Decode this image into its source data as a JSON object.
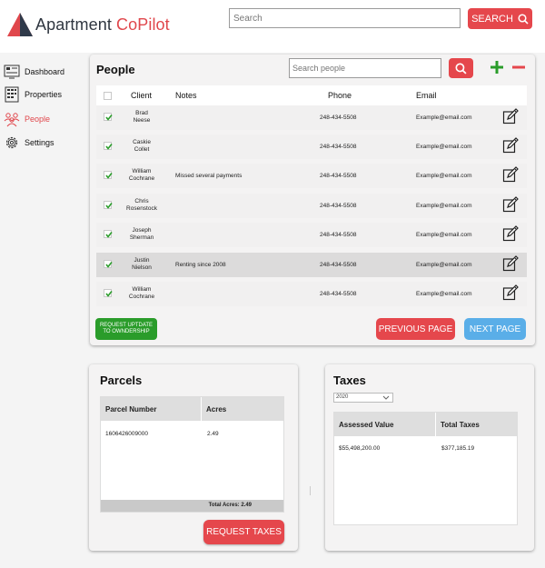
{
  "brand": {
    "part1": "Apartment ",
    "part2": "CoPilot"
  },
  "header": {
    "search_placeholder": "Search",
    "search_button": "SEARCH"
  },
  "sidebar": {
    "items": [
      {
        "label": "Dashboard",
        "icon": "dashboard-icon"
      },
      {
        "label": "Properties",
        "icon": "properties-icon"
      },
      {
        "label": "People",
        "icon": "people-icon",
        "active": true
      },
      {
        "label": "Settings",
        "icon": "gear-icon"
      }
    ]
  },
  "people": {
    "title": "People",
    "search_placeholder": "Search people",
    "columns": {
      "client": "Client",
      "notes": "Notes",
      "phone": "Phone",
      "email": "Email"
    },
    "rows": [
      {
        "client1": "Brad",
        "client2": "Neese",
        "notes": "",
        "phone": "248-434-5508",
        "email": "Example@email.com",
        "checked": true
      },
      {
        "client1": "Caskie",
        "client2": "Collet",
        "notes": "",
        "phone": "248-434-5508",
        "email": "Example@email.com",
        "checked": true
      },
      {
        "client1": "William",
        "client2": "Cochrane",
        "notes": "Missed several payments",
        "phone": "248-434-5508",
        "email": "Example@email.com",
        "checked": true
      },
      {
        "client1": "Chris",
        "client2": "Rosenstock",
        "notes": "",
        "phone": "248-434-5508",
        "email": "Example@email.com",
        "checked": true
      },
      {
        "client1": "Joseph",
        "client2": "Sherman",
        "notes": "",
        "phone": "248-434-5508",
        "email": "Example@email.com",
        "checked": true
      },
      {
        "client1": "Justin",
        "client2": "Nielson",
        "notes": "Renting since 2008",
        "phone": "248-434-5508",
        "email": "Example@email.com",
        "checked": true
      },
      {
        "client1": "William",
        "client2": "Cochrane",
        "notes": "",
        "phone": "248-434-5508",
        "email": "Example@email.com",
        "checked": true
      }
    ],
    "update_button_line1": "REQUEST UPTDATE",
    "update_button_line2": "TO OWNDERSHIP",
    "prev_button": "PREVIOUS PAGE",
    "next_button": "NEXT PAGE"
  },
  "parcels": {
    "title": "Parcels",
    "col1": "Parcel Number",
    "col2": "Acres",
    "rows": [
      {
        "number": "1606426009000",
        "acres": "2.49"
      }
    ],
    "total": "Total Acres: 2.49",
    "request_button": "REQUEST TAXES"
  },
  "taxes": {
    "title": "Taxes",
    "year": "2020",
    "col1": "Assessed Value",
    "col2": "Total Taxes",
    "rows": [
      {
        "assessed": "$55,498,200.00",
        "total": "$377,185.19"
      }
    ]
  },
  "colors": {
    "accent_red": "#e5474c",
    "green": "#2a9c2a",
    "blue": "#5aaee8"
  }
}
